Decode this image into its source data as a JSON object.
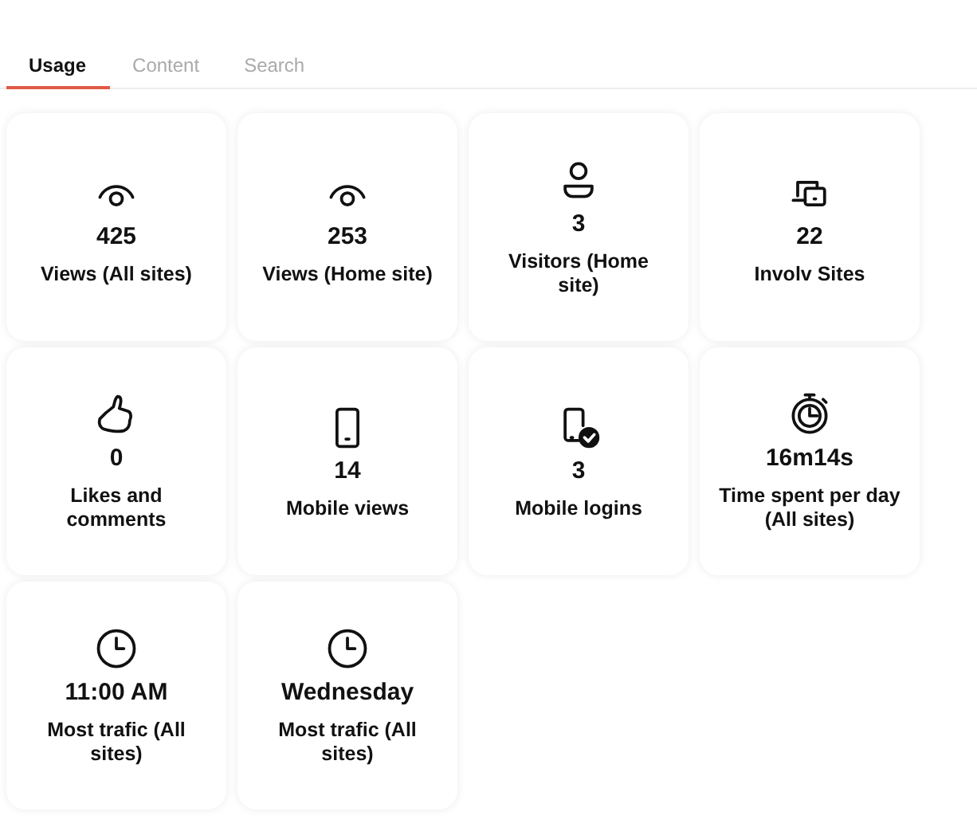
{
  "tabs": [
    {
      "label": "Usage",
      "selected": true
    },
    {
      "label": "Content",
      "selected": false
    },
    {
      "label": "Search",
      "selected": false
    }
  ],
  "cards": [
    {
      "kind": "eye",
      "value": "425",
      "label": "Views (All sites)"
    },
    {
      "kind": "eye",
      "value": "253",
      "label": "Views (Home site)"
    },
    {
      "kind": "person",
      "value": "3",
      "label": "Visitors (Home site)"
    },
    {
      "kind": "devices",
      "value": "22",
      "label": "Involv Sites"
    },
    {
      "kind": "thumb",
      "value": "0",
      "label": "Likes and comments"
    },
    {
      "kind": "phone",
      "value": "14",
      "label": "Mobile views"
    },
    {
      "kind": "phone-check",
      "value": "3",
      "label": "Mobile logins"
    },
    {
      "kind": "stopwatch",
      "value": "16m14s",
      "label": "Time spent per day (All sites)"
    },
    {
      "kind": "clock",
      "value": "11:00 AM",
      "label": "Most trafic (All sites)"
    },
    {
      "kind": "clock",
      "value": "Wednesday",
      "label": "Most trafic (All sites)"
    }
  ]
}
